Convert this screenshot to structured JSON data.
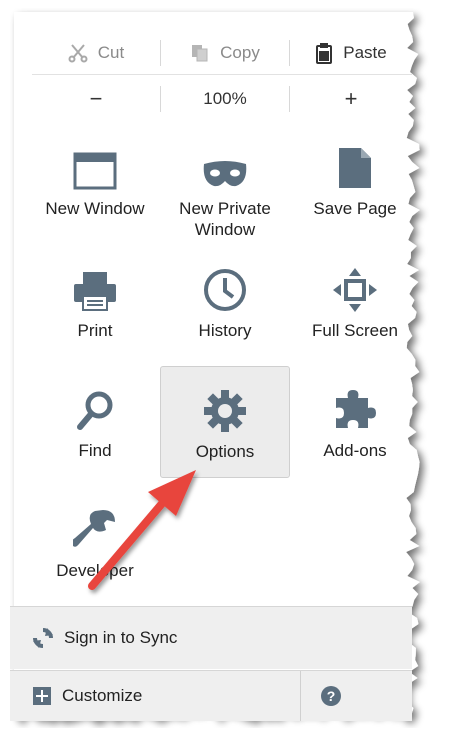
{
  "edit": {
    "cut_label": "Cut",
    "copy_label": "Copy",
    "paste_label": "Paste"
  },
  "zoom": {
    "minus_label": "−",
    "level": "100%",
    "plus_label": "+"
  },
  "items": [
    {
      "label": "New Window",
      "icon": "window-icon"
    },
    {
      "label": "New Private\nWindow",
      "icon": "mask-icon"
    },
    {
      "label": "Save Page",
      "icon": "page-icon"
    },
    {
      "label": "Print",
      "icon": "printer-icon"
    },
    {
      "label": "History",
      "icon": "clock-icon"
    },
    {
      "label": "Full Screen",
      "icon": "fullscreen-icon"
    },
    {
      "label": "Find",
      "icon": "magnifier-icon"
    },
    {
      "label": "Options",
      "icon": "gear-icon"
    },
    {
      "label": "Add-ons",
      "icon": "puzzle-icon"
    },
    {
      "label": "Developer",
      "icon": "wrench-icon"
    }
  ],
  "footer": {
    "sync_label": "Sign in to Sync",
    "customize_label": "Customize"
  },
  "colors": {
    "icon": "#5b6e7e",
    "arrow": "#e8443e",
    "selected_bg": "#ececec"
  }
}
